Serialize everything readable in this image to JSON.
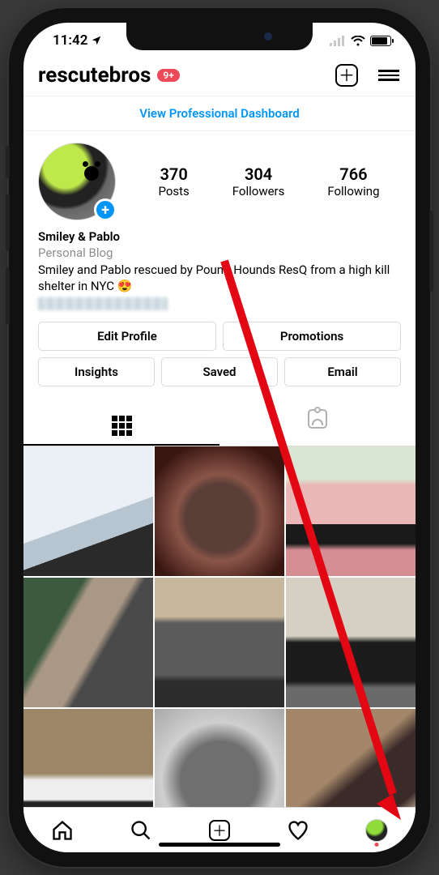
{
  "status": {
    "time": "11:42"
  },
  "header": {
    "username": "rescutebros",
    "notification_badge": "9+"
  },
  "dashboard_link": "View Professional Dashboard",
  "stats": {
    "posts": {
      "value": "370",
      "label": "Posts"
    },
    "followers": {
      "value": "304",
      "label": "Followers"
    },
    "following": {
      "value": "766",
      "label": "Following"
    }
  },
  "bio": {
    "display_name": "Smiley & Pablo",
    "category": "Personal Blog",
    "text": "Smiley and Pablo rescued by Pound Hounds ResQ from a high kill shelter in NYC 😍"
  },
  "buttons": {
    "edit_profile": "Edit Profile",
    "promotions": "Promotions",
    "insights": "Insights",
    "saved": "Saved",
    "email": "Email"
  }
}
